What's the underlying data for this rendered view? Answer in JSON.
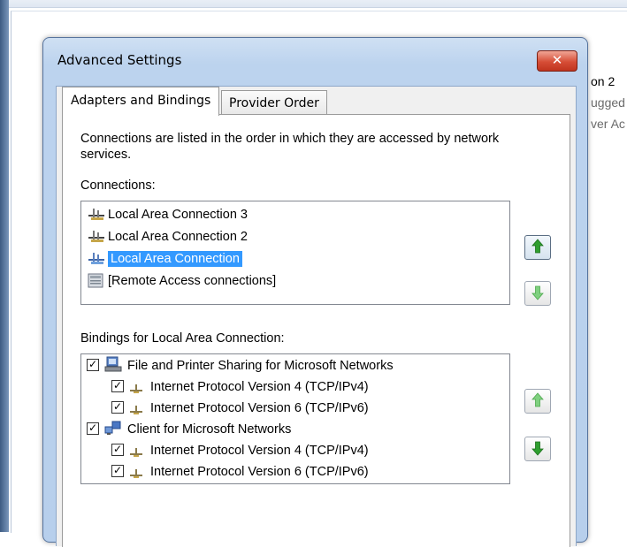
{
  "background_window": {
    "lines": [
      "on 2",
      "ugged",
      "ver Ac"
    ]
  },
  "dialog": {
    "title": "Advanced Settings",
    "close_glyph": "✕",
    "tabs": [
      {
        "label": "Adapters and Bindings",
        "active": true
      },
      {
        "label": "Provider Order",
        "active": false
      }
    ],
    "description": "Connections are listed in the order in which they are accessed by network services.",
    "connections_label": "Connections:",
    "connections": [
      {
        "label": "Local Area Connection 3",
        "icon": "network-adapter-icon",
        "selected": false
      },
      {
        "label": "Local Area Connection 2",
        "icon": "network-adapter-icon",
        "selected": false
      },
      {
        "label": "Local Area Connection",
        "icon": "network-adapter-icon",
        "selected": true
      },
      {
        "label": "[Remote Access connections]",
        "icon": "remote-access-icon",
        "selected": false
      }
    ],
    "bindings_label": "Bindings for Local Area Connection:",
    "bindings": [
      {
        "label": "File and Printer Sharing for Microsoft Networks",
        "checked": true,
        "level": 0,
        "icon": "file-printer-sharing-icon"
      },
      {
        "label": "Internet Protocol Version 4 (TCP/IPv4)",
        "checked": true,
        "level": 1,
        "icon": "protocol-icon"
      },
      {
        "label": "Internet Protocol Version 6 (TCP/IPv6)",
        "checked": true,
        "level": 1,
        "icon": "protocol-icon"
      },
      {
        "label": "Client for Microsoft Networks",
        "checked": true,
        "level": 0,
        "icon": "client-network-icon"
      },
      {
        "label": "Internet Protocol Version 4 (TCP/IPv4)",
        "checked": true,
        "level": 1,
        "icon": "protocol-icon"
      },
      {
        "label": "Internet Protocol Version 6 (TCP/IPv6)",
        "checked": true,
        "level": 1,
        "icon": "protocol-icon"
      }
    ],
    "check_glyph": "✓",
    "colors": {
      "selection": "#3399ff",
      "arrow_green": "#2f9e2f",
      "close_red": "#d64d36"
    }
  }
}
